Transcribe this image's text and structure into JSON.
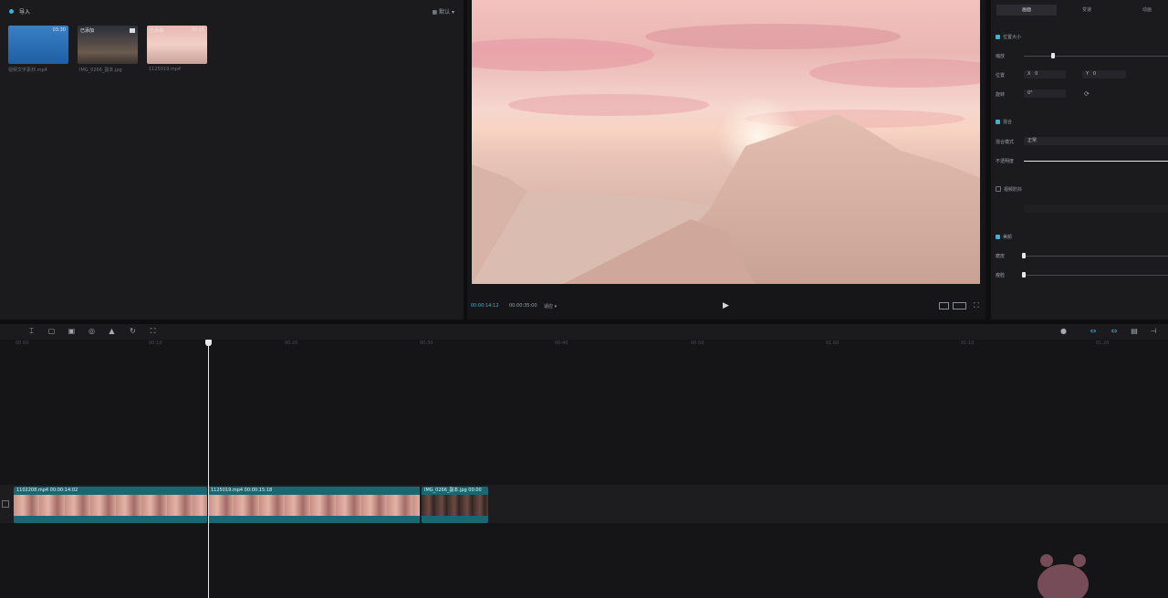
{
  "media": {
    "import_label": "导入",
    "sort_label": "默认",
    "thumbnails": [
      {
        "tag": "",
        "duration": "03:30",
        "name": "视频文字素材.mp4"
      },
      {
        "tag": "已添加",
        "duration": "",
        "name": "IMG_0266_副本.jpg"
      },
      {
        "tag": "已添加",
        "duration": "00:15",
        "name": "1125019.mp4"
      }
    ]
  },
  "preview": {
    "current_time": "00:00:14:12",
    "total_time": "00:00:35:00",
    "ratio_label": "适应"
  },
  "inspector": {
    "tabs": [
      "画面",
      "变速",
      "动画"
    ],
    "section_size": "位置大小",
    "scale_label": "缩放",
    "position_label": "位置",
    "pos_x_label": "X",
    "pos_x_value": "0",
    "pos_y_label": "Y",
    "pos_y_value": "0",
    "rotate_label": "旋转",
    "rotate_value": "0°",
    "section_blend": "混合",
    "blend_mode_label": "混合模式",
    "blend_mode_value": "正常",
    "opacity_label": "不透明度",
    "section_stabilize": "视频防抖",
    "section_adjust": "美颜",
    "smooth_label": "磨皮",
    "thin_label": "瘦脸",
    "scale_level": 0.2,
    "opacity_level": 1.0,
    "smooth_level": 0.0,
    "thin_level": 0.0
  },
  "timeline": {
    "ticks": [
      "00:00",
      "00:10",
      "00:20",
      "00:30",
      "00:40",
      "00:50",
      "01:00",
      "01:10",
      "01:20"
    ],
    "clips": [
      {
        "label": "1102208.mp4   00:00:14:02"
      },
      {
        "label": "1125019.mp4   00:00:15:18"
      },
      {
        "label": "IMG_0266_副本.jpg   00:00"
      }
    ]
  },
  "colors": {
    "accent": "#35b6d8",
    "clip": "#1a6673"
  }
}
